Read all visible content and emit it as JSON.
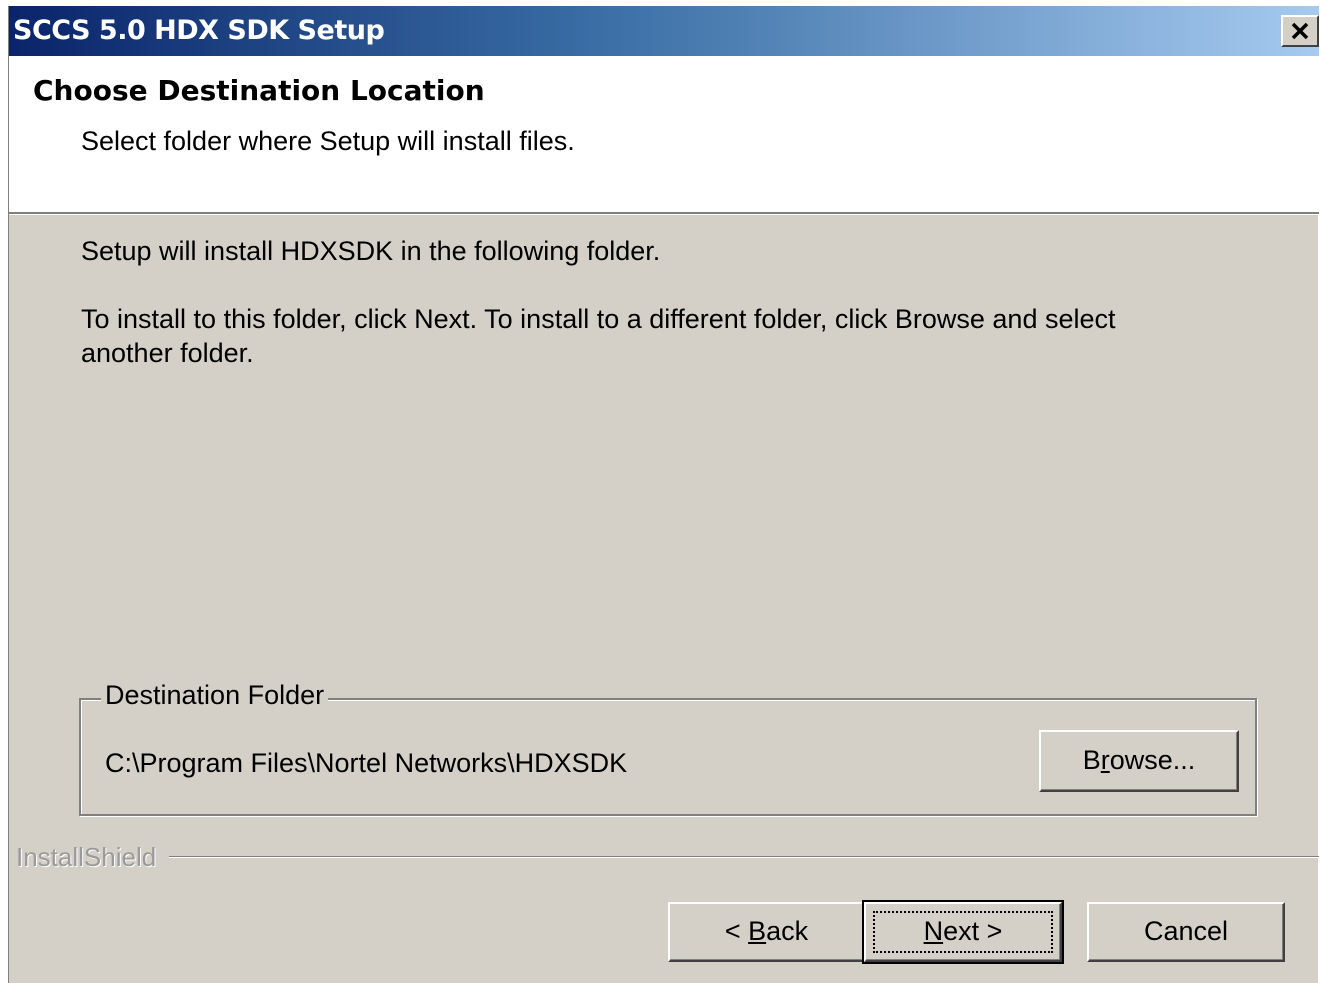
{
  "window": {
    "title": "SCCS 5.0 HDX SDK Setup",
    "close_icon": "close-icon"
  },
  "header": {
    "title": "Choose Destination Location",
    "subtitle": "Select folder where Setup will install files."
  },
  "body": {
    "line1": "Setup will install HDXSDK in the following folder.",
    "line2": "To install to this folder, click Next. To install to a different folder, click Browse and select another folder."
  },
  "destination": {
    "group_label": "Destination Folder",
    "path": "C:\\Program Files\\Nortel Networks\\HDXSDK",
    "browse_pre": "B",
    "browse_accel": "r",
    "browse_post": "owse..."
  },
  "footer": {
    "brand": "InstallShield",
    "back_pre": "< ",
    "back_accel": "B",
    "back_post": "ack",
    "next_accel": "N",
    "next_post": "ext >",
    "cancel_label": "Cancel"
  },
  "colors": {
    "title_gradient_start": "#0a246a",
    "title_gradient_end": "#a6caf0",
    "dialog_face": "#d4d0c8",
    "header_bg": "#ffffff"
  }
}
